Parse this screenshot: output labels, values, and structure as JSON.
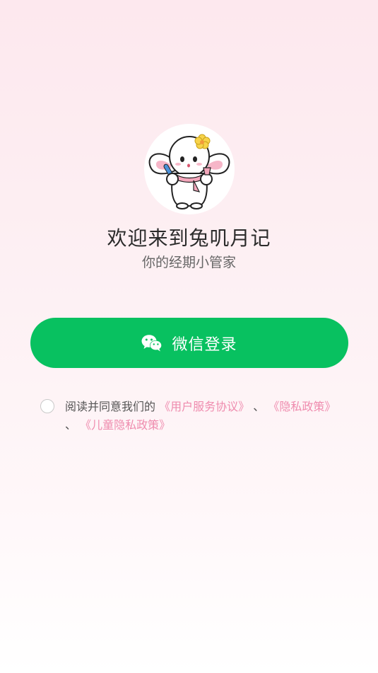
{
  "welcome": {
    "title": "欢迎来到兔叽月记",
    "subtitle": "你的经期小管家"
  },
  "login": {
    "wechat_label": "微信登录"
  },
  "agreement": {
    "prefix": "阅读并同意我们的",
    "user_agreement": "《用户服务协议》",
    "separator_1": "、",
    "privacy_policy": "《隐私政策》",
    "separator_2": "、",
    "children_privacy_policy": "《儿童隐私政策》",
    "checked": false
  },
  "colors": {
    "wechat_green": "#08c160",
    "link_pink": "#ef8bae",
    "title_text": "#2b2b2b"
  },
  "icons": {
    "logo": "bunny-mascot-icon",
    "wechat": "wechat-icon",
    "agree_checkbox": "radio-circle-icon"
  }
}
